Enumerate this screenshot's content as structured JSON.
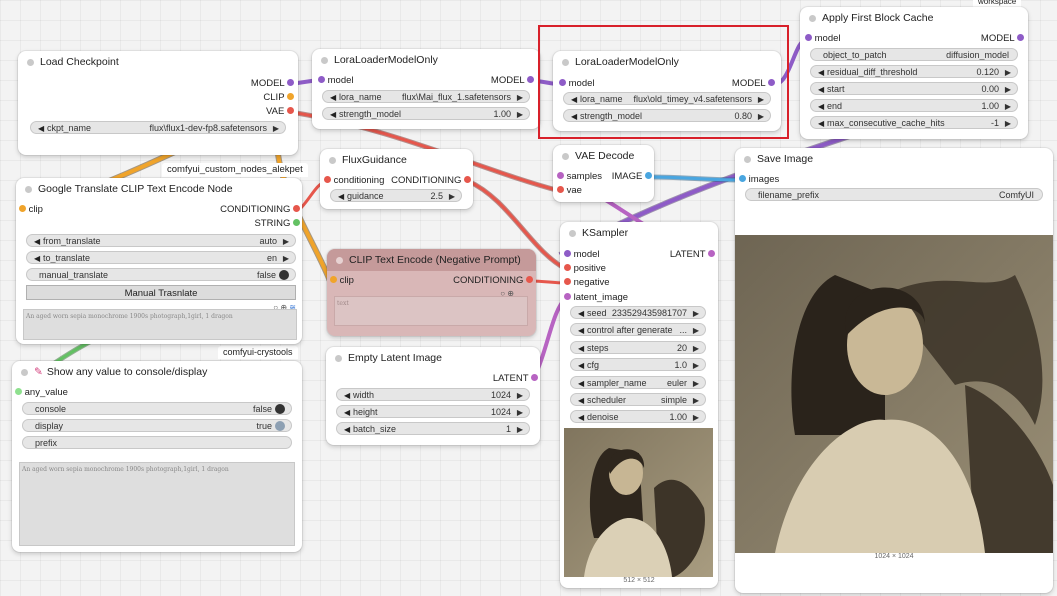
{
  "workspace_tag": "workspace",
  "groups": {
    "alekpet": "comfyui_custom_nodes_alekpet",
    "crystools": "comfyui-crystools"
  },
  "load_checkpoint": {
    "title": "Load Checkpoint",
    "outputs": [
      "MODEL",
      "CLIP",
      "VAE"
    ],
    "ckpt_name_label": "ckpt_name",
    "ckpt_name_value": "flux\\flux1-dev-fp8.safetensors"
  },
  "lora1": {
    "title": "LoraLoaderModelOnly",
    "input": "model",
    "output": "MODEL",
    "lora_name_label": "lora_name",
    "lora_name_value": "flux\\Mai_flux_1.safetensors",
    "strength_label": "strength_model",
    "strength_value": "1.00"
  },
  "lora2": {
    "title": "LoraLoaderModelOnly",
    "input": "model",
    "output": "MODEL",
    "lora_name_label": "lora_name",
    "lora_name_value": "flux\\old_timey_v4.safetensors",
    "strength_label": "strength_model",
    "strength_value": "0.80"
  },
  "first_block_cache": {
    "title": "Apply First Block Cache",
    "input": "model",
    "output": "MODEL",
    "widgets": [
      {
        "label": "object_to_patch",
        "value": "diffusion_model"
      },
      {
        "label": "residual_diff_threshold",
        "value": "0.120"
      },
      {
        "label": "start",
        "value": "0.00"
      },
      {
        "label": "end",
        "value": "1.00"
      },
      {
        "label": "max_consecutive_cache_hits",
        "value": "-1"
      }
    ]
  },
  "flux_guidance": {
    "title": "FluxGuidance",
    "input": "conditioning",
    "output": "CONDITIONING",
    "guidance_label": "guidance",
    "guidance_value": "2.5"
  },
  "vae_decode": {
    "title": "VAE Decode",
    "inputs": [
      "samples",
      "vae"
    ],
    "output": "IMAGE"
  },
  "save_image": {
    "title": "Save Image",
    "input": "images",
    "prefix_label": "filename_prefix",
    "prefix_value": "ComfyUI",
    "caption": "1024 × 1024"
  },
  "google_translate": {
    "title": "Google Translate CLIP Text Encode Node",
    "input": "clip",
    "outputs": [
      "CONDITIONING",
      "STRING"
    ],
    "from_label": "from_translate",
    "from_value": "auto",
    "to_label": "to_translate",
    "to_value": "en",
    "manual_label": "manual_translate",
    "manual_value": "false",
    "manual_button": "Manual Trasnlate",
    "prompt_text": "An aged worn sepia monochrome 1900s photograph,1girl, 1 dragon"
  },
  "clip_negative": {
    "title": "CLIP Text Encode (Negative Prompt)",
    "input": "clip",
    "output": "CONDITIONING",
    "text_placeholder": "text"
  },
  "ksampler": {
    "title": "KSampler",
    "inputs": [
      "model",
      "positive",
      "negative",
      "latent_image"
    ],
    "output": "LATENT",
    "widgets": [
      {
        "label": "seed",
        "value": "233529435981707"
      },
      {
        "label": "control after generate",
        "value": "..."
      },
      {
        "label": "steps",
        "value": "20"
      },
      {
        "label": "cfg",
        "value": "1.0"
      },
      {
        "label": "sampler_name",
        "value": "euler"
      },
      {
        "label": "scheduler",
        "value": "simple"
      },
      {
        "label": "denoise",
        "value": "1.00"
      }
    ],
    "caption": "512 × 512"
  },
  "empty_latent": {
    "title": "Empty Latent Image",
    "output": "LATENT",
    "widgets": [
      {
        "label": "width",
        "value": "1024"
      },
      {
        "label": "height",
        "value": "1024"
      },
      {
        "label": "batch_size",
        "value": "1"
      }
    ]
  },
  "show_any": {
    "title": "Show any value to console/display",
    "input": "any_value",
    "console_label": "console",
    "console_value": "false",
    "display_label": "display",
    "display_value": "true",
    "prefix_label": "prefix",
    "text": "An aged worn sepia monochrome 1900s photograph,1girl, 1 dragon"
  },
  "icons": [
    "pushpin-icon",
    "circle-icon",
    "plus-circle-icon",
    "chart-icon"
  ],
  "colors": {
    "model_wire": "#8e5cc7",
    "clip_wire": "#f0a42b",
    "vae_wire": "#e6574c",
    "conditioning_wire": "#e6574c",
    "latent_wire": "#b763c2",
    "image_wire": "#4aa6e0",
    "selection": "#d8202a",
    "negative_node": "#d9b7b7"
  }
}
